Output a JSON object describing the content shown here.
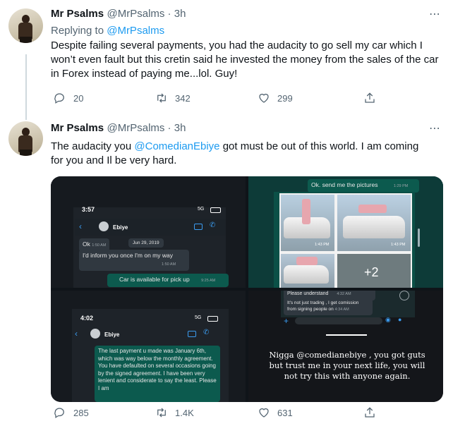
{
  "tweet1": {
    "name": "Mr Psalms",
    "handle": "@MrPsalms · 3h",
    "replying_prefix": "Replying to ",
    "replying_handle": "@MrPsalms",
    "text": "Despite failing several payments, you had the audacity to go sell my car which I won’t even fault but this cretin said he invested the money from the sales of the car in Forex instead of paying me...lol. Guy!",
    "replies": "20",
    "retweets": "342",
    "likes": "299"
  },
  "tweet2": {
    "name": "Mr Psalms",
    "handle": "@MrPsalms · 3h",
    "text_before": "The audacity you ",
    "mention": "@ComedianEbiye",
    "text_after": " got must be out of this world. I am coming for you and Il be very hard.",
    "replies": "285",
    "retweets": "1.4K",
    "likes": "631"
  },
  "media": {
    "img1": {
      "time": "3:57",
      "status": "5G",
      "contact": "Ebiye",
      "ok": "Ok",
      "ok_time": "1:50 AM",
      "date": "Jun 29, 2019",
      "msg1": "I'd inform you once I'm on my way",
      "msg1_time": "1:50 AM",
      "msg2": "Car is available for pick up",
      "msg2_time": "9:25 AM"
    },
    "img2": {
      "msg": "Ok. send me the pictures",
      "msg_time": "1:29 PM",
      "photo_time1": "1:43 PM",
      "photo_time2": "1:43 PM",
      "more": "+2"
    },
    "img3": {
      "time": "4:02",
      "status": "5G",
      "contact": "Ebiye",
      "msg": "The last payment u made was January 6th, which was way below the monthly agreement. You have defaulted on several occasions going by the signed agreement. I have been very lenient and considerate to say the least. Please I am"
    },
    "img4": {
      "top1": "Please understand",
      "top1_time": "4:32 AM",
      "top2": "It's not just trading , I get comission from signing people on",
      "top2_time": "4:34 AM",
      "caption": "Nigga @comedianebiye , you got guts but trust me in your next life, you will not try this with anyone again."
    }
  }
}
